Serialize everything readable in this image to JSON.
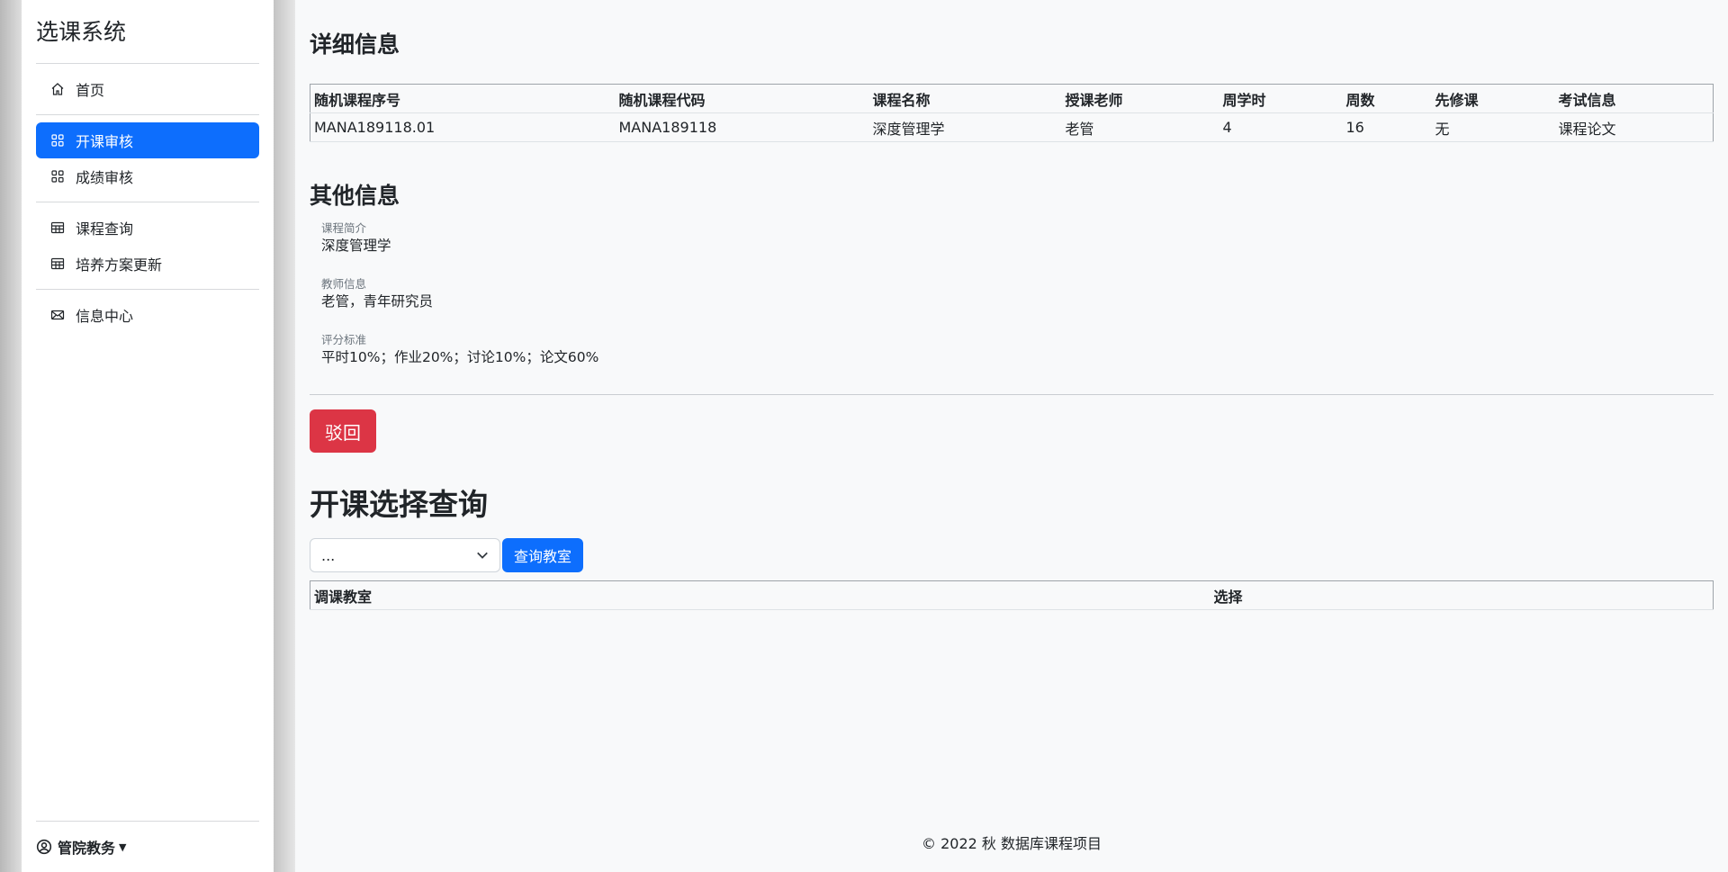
{
  "sidebar": {
    "brand": "选课系统",
    "groups": [
      [
        {
          "label": "首页",
          "icon": "home-icon",
          "active": false
        }
      ],
      [
        {
          "label": "开课审核",
          "icon": "grid-icon",
          "active": true
        },
        {
          "label": "成绩审核",
          "icon": "grid-icon",
          "active": false
        }
      ],
      [
        {
          "label": "课程查询",
          "icon": "table-icon",
          "active": false
        },
        {
          "label": "培养方案更新",
          "icon": "table-icon",
          "active": false
        }
      ],
      [
        {
          "label": "信息中心",
          "icon": "envelope-icon",
          "active": false
        }
      ]
    ],
    "user": "管院教务"
  },
  "detail": {
    "title": "详细信息",
    "headers": [
      "随机课程序号",
      "随机课程代码",
      "课程名称",
      "授课老师",
      "周学时",
      "周数",
      "先修课",
      "考试信息"
    ],
    "rows": [
      [
        "MANA189118.01",
        "MANA189118",
        "深度管理学",
        "老管",
        "4",
        "16",
        "无",
        "课程论文"
      ]
    ]
  },
  "other": {
    "title": "其他信息",
    "items": [
      {
        "label": "课程简介",
        "value": "深度管理学"
      },
      {
        "label": "教师信息",
        "value": "老管，青年研究员"
      },
      {
        "label": "评分标准",
        "value": "平时10%；作业20%；讨论10%；论文60%"
      }
    ]
  },
  "actions": {
    "reject_label": "驳回"
  },
  "selection": {
    "title": "开课选择查询",
    "select_value": "...",
    "query_label": "查询教室",
    "headers": [
      "调课教室",
      "选择"
    ]
  },
  "footer": {
    "copyright": "© 2022 秋 数据库课程项目"
  },
  "colors": {
    "primary": "#0d6efd",
    "danger": "#dc3545"
  }
}
